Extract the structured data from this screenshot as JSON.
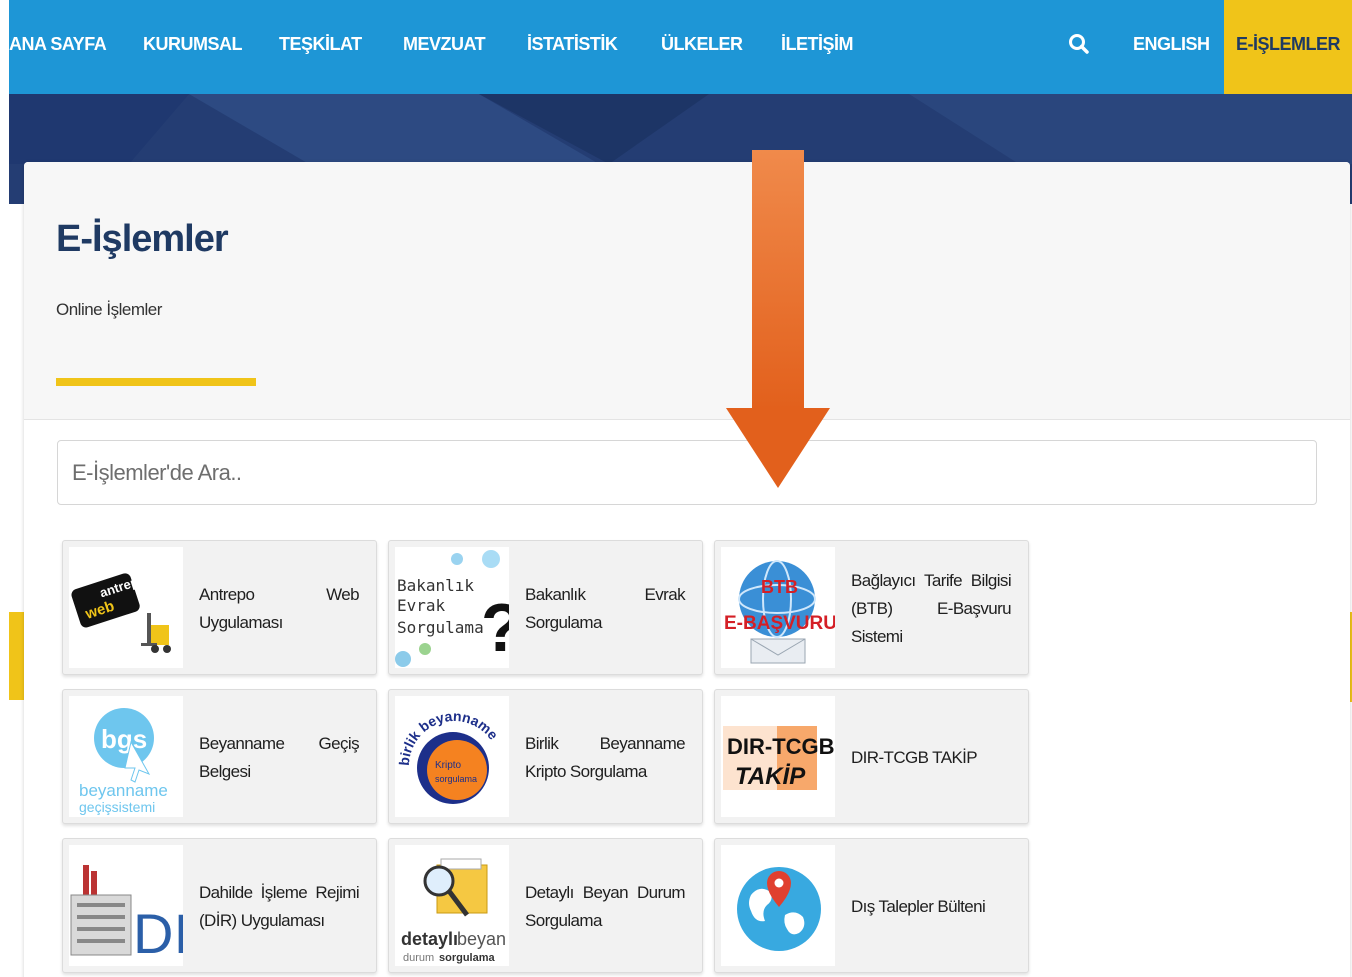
{
  "nav": {
    "items": [
      "ANA SAYFA",
      "KURUMSAL",
      "TEŞKİLAT",
      "MEVZUAT",
      "İSTATİSTİK",
      "ÜLKELER",
      "İLETİŞİM"
    ],
    "english": "ENGLISH",
    "eislemler": "E-İŞLEMLER",
    "search_icon": "search-icon"
  },
  "page": {
    "title": "E-İşlemler",
    "subtitle": "Online İşlemler"
  },
  "search": {
    "placeholder": "E-İşlemler'de Ara.."
  },
  "tiles": [
    {
      "label": "Antrepo Web Uygulaması",
      "icon": "antrepo-web-logo"
    },
    {
      "label": "Bakanlık Evrak Sorgulama",
      "icon": "bakanlik-evrak-sorgulama-logo",
      "img_text": [
        "Bakanlık",
        "Evrak",
        "Sorgulama"
      ]
    },
    {
      "label": "Bağlayıcı Tarife Bilgisi (BTB) E-Başvuru Sistemi",
      "icon": "btb-ebasvuru-logo",
      "img_text": [
        "BTB",
        "E-BAŞVURU"
      ]
    },
    {
      "label": "Beyanname Geçiş Belgesi",
      "icon": "bgs-logo",
      "img_text": [
        "bgs",
        "beyanname",
        "geçişsistemi"
      ]
    },
    {
      "label": "Birlik Beyanname Kripto Sorgulama",
      "icon": "birlik-beyanname-logo",
      "img_text": [
        "birlik beyanname",
        "Kripto sorgulama"
      ]
    },
    {
      "label": "DIR-TCGB TAKİP",
      "icon": "dir-tcgb-takip-logo",
      "img_text": [
        "DIR-TCGB",
        "TAKİP"
      ]
    },
    {
      "label": "Dahilde İşleme Rejimi (DİR) Uygulaması",
      "icon": "dir-logo",
      "img_text": [
        "DIR"
      ]
    },
    {
      "label": "Detaylı Beyan Durum Sorgulama",
      "icon": "detayli-beyan-logo",
      "img_text": [
        "detaylı",
        "beyan",
        "durum",
        "sorgulama"
      ]
    },
    {
      "label": "Dış Talepler Bülteni",
      "icon": "world-map-pin-logo"
    }
  ],
  "colors": {
    "nav_blue": "#1e96d6",
    "accent_yellow": "#f0c419",
    "title_navy": "#1f3a63",
    "arrow_orange": "#e8702a"
  }
}
